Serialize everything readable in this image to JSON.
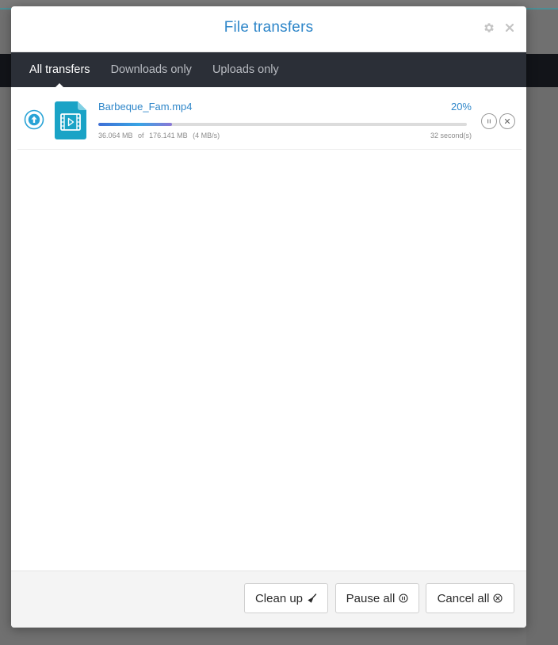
{
  "modal": {
    "title": "File transfers",
    "settings_icon": "gear-icon",
    "close_icon": "close-icon"
  },
  "tabs": [
    {
      "label": "All transfers",
      "active": true
    },
    {
      "label": "Downloads only",
      "active": false
    },
    {
      "label": "Uploads only",
      "active": false
    }
  ],
  "transfers": [
    {
      "direction": "upload",
      "direction_icon": "upload-arrow-icon",
      "file_icon": "video-file-icon",
      "file_name": "Barbeque_Fam.mp4",
      "percent": "20%",
      "progress": 0.2,
      "transferred": "36.064 MB",
      "of_label": "of",
      "total": "176.141 MB",
      "speed": "(4 MB/s)",
      "eta": "32 second(s)"
    }
  ],
  "footer": {
    "cleanup_label": "Clean up",
    "pause_all_label": "Pause all",
    "cancel_all_label": "Cancel all"
  },
  "colors": {
    "accent": "#2e86c9",
    "tab_bar": "#2b2f37",
    "file_icon": "#1aa3c6"
  }
}
